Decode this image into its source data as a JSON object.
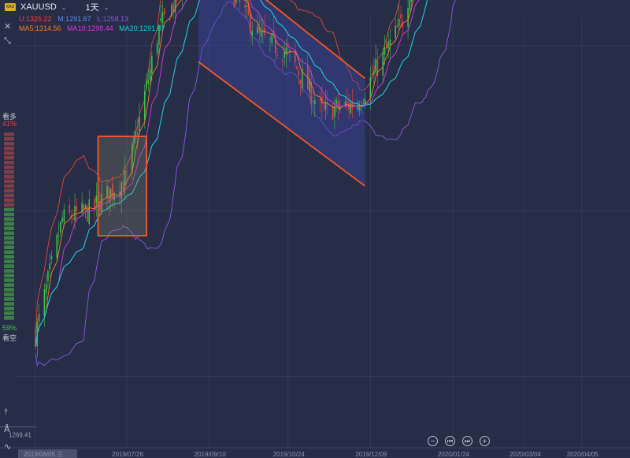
{
  "header": {
    "logo_text": "XAU",
    "symbol": "XAUUSD",
    "period": "1天",
    "bollinger": {
      "upper_label": "U:1325.22",
      "middle_label": "M:1291.67",
      "lower_label": "L:1258.13"
    },
    "ma": {
      "ma5_label": "MA5:1314.56",
      "ma10_label": "MA10:1298.44",
      "ma20_label": "MA20:1291.67"
    }
  },
  "sentiment": {
    "bull_label": "看多",
    "bull_pct": "41%",
    "bear_pct": "59%",
    "bear_label": "看空",
    "bull_fraction": 0.41
  },
  "price_labels": {
    "high": "1649.15",
    "low": "1269.41"
  },
  "colors": {
    "bg": "#272d47",
    "grid": "#323a58",
    "bull_candle": "#3fbf4a",
    "bear_candle": "#e0453a",
    "ma5": "#ff7a2a",
    "ma10": "#d13ae0",
    "ma20": "#1ec8d8",
    "boll_upper": "#e0453a",
    "boll_lower": "#8a55e8",
    "annotation": "#e8542d",
    "channel_fill": "#3c48a0"
  },
  "icons": [
    "close-icon",
    "collapse-icon",
    "indicator-icon",
    "draw-icon",
    "wave-icon",
    "zoom-out-icon",
    "step-back-icon",
    "step-forward-icon",
    "zoom-in-icon"
  ],
  "chart_data": {
    "type": "candlestick",
    "instrument": "XAUUSD",
    "x_axis_labels": [
      "2019/06/05 三",
      "2019/07/26",
      "2019/09/10",
      "2019/10/24",
      "2019/12/09",
      "2020/01/24",
      "2020/03/04",
      "2020/04/05"
    ],
    "overlays": [
      "MA5",
      "MA10",
      "MA20",
      "Bollinger Bands"
    ],
    "close_path": [
      [
        "2019/06/05",
        1325
      ],
      [
        "2019/06/20",
        1395
      ],
      [
        "2019/07/05",
        1400
      ],
      [
        "2019/07/26",
        1420
      ],
      [
        "2019/08/13",
        1510
      ],
      [
        "2019/09/04",
        1550
      ],
      [
        "2019/09/24",
        1530
      ],
      [
        "2019/10/08",
        1505
      ],
      [
        "2019/10/24",
        1495
      ],
      [
        "2019/11/12",
        1460
      ],
      [
        "2019/12/02",
        1465
      ],
      [
        "2019/12/27",
        1515
      ],
      [
        "2020/01/08",
        1570
      ],
      [
        "2020/01/24",
        1575
      ],
      [
        "2020/02/12",
        1580
      ],
      [
        "2020/02/24",
        1649
      ]
    ],
    "annotations": {
      "rect_1": {
        "from": "2019/07/10",
        "to": "2019/08/06",
        "low": 1385,
        "high": 1445
      },
      "rect_2": {
        "from": "2019/12/31",
        "to": "2020/02/28",
        "low": 1545,
        "high": 1612
      },
      "channel": {
        "from": "2019/09/04",
        "to": "2019/12/06",
        "upper_start": 1560,
        "upper_end": 1480,
        "lower_start": 1490,
        "lower_end": 1415
      },
      "arrow": {
        "from": [
          "2020/02/24",
          1640
        ],
        "to": [
          "2020/03/11",
          1755
        ]
      }
    },
    "y_visible_range": [
      1240,
      1770
    ],
    "grid": true
  }
}
